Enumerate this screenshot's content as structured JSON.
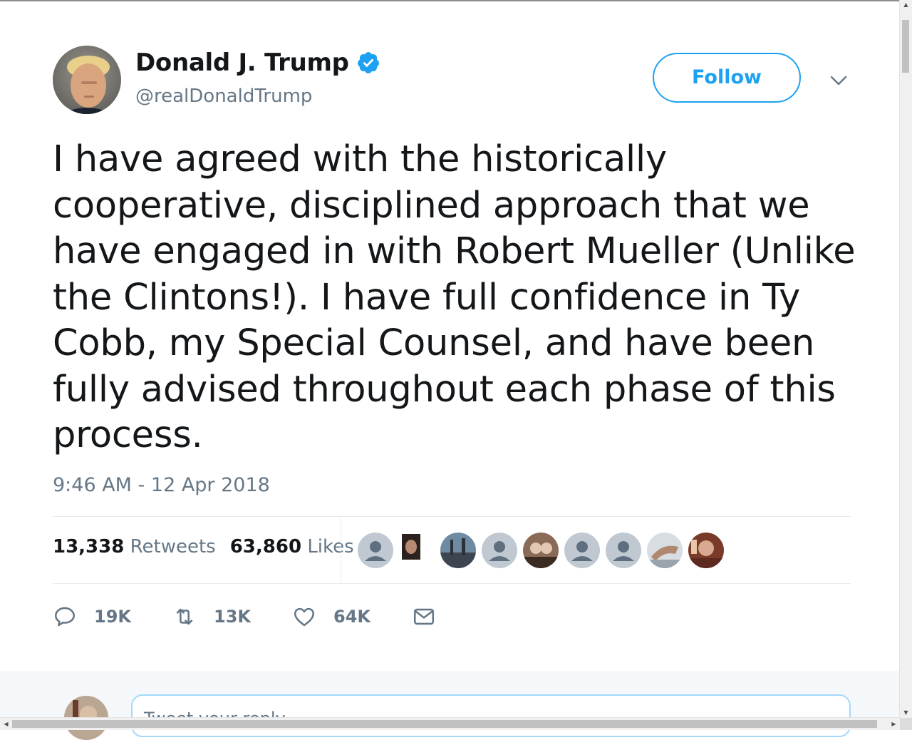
{
  "author": {
    "name": "Donald J. Trump",
    "handle": "@realDonaldTrump",
    "verified": true
  },
  "follow_label": "Follow",
  "tweet": {
    "text": "I have agreed with the historically\ncooperative, disciplined approach that we\nhave engaged in with Robert Mueller (Unlike\nthe Clintons!). I have full confidence in Ty\nCobb, my Special Counsel, and have been\nfully advised throughout each phase of this\nprocess.",
    "timestamp": "9:46 AM - 12 Apr 2018"
  },
  "stats": {
    "retweets_count": "13,338",
    "retweets_label": "Retweets",
    "likes_count": "63,860",
    "likes_label": "Likes"
  },
  "actions": {
    "reply_count": "19K",
    "retweet_count": "13K",
    "like_count": "64K"
  },
  "reply_placeholder": "Tweet your reply",
  "colors": {
    "accent": "#1da1f2",
    "secondary_text": "#657786",
    "primary_text": "#14171a"
  },
  "icons": {
    "verified": "verified-badge-icon",
    "caret": "chevron-down-icon",
    "reply": "reply-icon",
    "retweet": "retweet-icon",
    "like": "heart-icon",
    "dm": "envelope-icon"
  }
}
